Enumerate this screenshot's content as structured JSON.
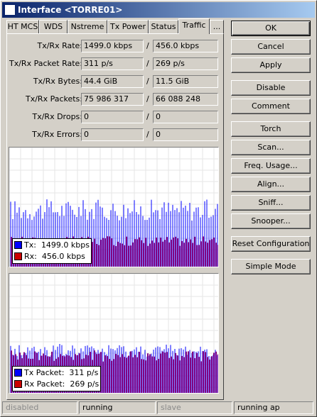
{
  "window": {
    "title": "Interface <TORRE01>"
  },
  "tabs": [
    {
      "label": "HT MCS"
    },
    {
      "label": "WDS"
    },
    {
      "label": "Nstreme"
    },
    {
      "label": "Tx Power"
    },
    {
      "label": "Status"
    },
    {
      "label": "Traffic",
      "active": true
    },
    {
      "label": "..."
    }
  ],
  "stats": {
    "rate": {
      "label": "Tx/Rx Rate:",
      "tx": "1499.0 kbps",
      "rx": "456.0 kbps"
    },
    "packet_rate": {
      "label": "Tx/Rx Packet Rate:",
      "tx": "311 p/s",
      "rx": "269 p/s"
    },
    "bytes": {
      "label": "Tx/Rx Bytes:",
      "tx": "44.4 GiB",
      "rx": "11.5 GiB"
    },
    "packets": {
      "label": "Tx/Rx Packets:",
      "tx": "75 986 317",
      "rx": "66 088 248"
    },
    "drops": {
      "label": "Tx/Rx Drops:",
      "tx": "0",
      "rx": "0"
    },
    "errors": {
      "label": "Tx/Rx Errors:",
      "tx": "0",
      "rx": "0"
    },
    "separator": "/"
  },
  "graph1": {
    "legend": {
      "tx_label": "Tx:",
      "tx_value": "1499.0 kbps",
      "rx_label": "Rx:",
      "rx_value": "456.0 kbps"
    }
  },
  "graph2": {
    "legend": {
      "tx_label": "Tx Packet:",
      "tx_value": "311 p/s",
      "rx_label": "Rx Packet:",
      "rx_value": "269 p/s"
    }
  },
  "colors": {
    "tx": "#0000ff",
    "rx": "#cc0000",
    "rx_fill": "#800080"
  },
  "buttons": {
    "ok": "OK",
    "cancel": "Cancel",
    "apply": "Apply",
    "disable": "Disable",
    "comment": "Comment",
    "torch": "Torch",
    "scan": "Scan...",
    "freq_usage": "Freq. Usage...",
    "align": "Align...",
    "sniff": "Sniff...",
    "snooper": "Snooper...",
    "reset_config": "Reset Configuration",
    "simple_mode": "Simple Mode"
  },
  "statusbar": {
    "s1": "disabled",
    "s2": "running",
    "s3": "slave",
    "s4": "running ap"
  }
}
